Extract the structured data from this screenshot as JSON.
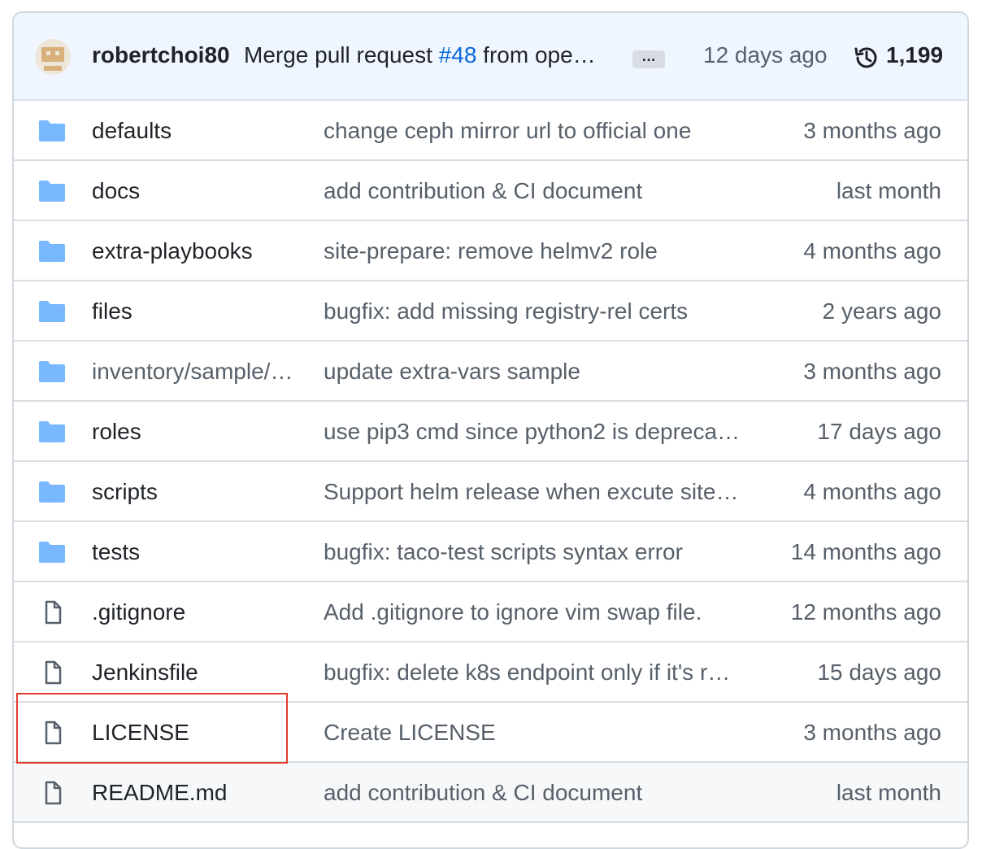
{
  "header": {
    "author": "robertchoi80",
    "message_prefix": "Merge pull request ",
    "pr_link": "#48",
    "message_suffix": " from ope…",
    "ellipsis": "…",
    "age": "12 days ago",
    "commit_count": "1,199",
    "icons": {
      "avatar": "user-avatar",
      "history": "history-clock-icon"
    }
  },
  "files": [
    {
      "type": "folder",
      "name": "defaults",
      "message": "change ceph mirror url to official one",
      "age": "3 months ago"
    },
    {
      "type": "folder",
      "name": "docs",
      "message": "add contribution & CI document",
      "age": "last month"
    },
    {
      "type": "folder",
      "name": "extra-playbooks",
      "message": "site-prepare: remove helmv2 role",
      "age": "4 months ago"
    },
    {
      "type": "folder",
      "name": "files",
      "message": "bugfix: add missing registry-rel certs",
      "age": "2 years ago"
    },
    {
      "type": "folder",
      "name": "inventory/sample/…",
      "message": "update extra-vars sample",
      "age": "3 months ago"
    },
    {
      "type": "folder",
      "name": "roles",
      "message": "use pip3 cmd since python2 is depreca…",
      "age": "17 days ago"
    },
    {
      "type": "folder",
      "name": "scripts",
      "message": "Support helm release when excute site…",
      "age": "4 months ago"
    },
    {
      "type": "folder",
      "name": "tests",
      "message": "bugfix: taco-test scripts syntax error",
      "age": "14 months ago"
    },
    {
      "type": "file",
      "name": ".gitignore",
      "message": "Add .gitignore to ignore vim swap file.",
      "age": "12 months ago"
    },
    {
      "type": "file",
      "name": "Jenkinsfile",
      "message": "bugfix: delete k8s endpoint only if it's r…",
      "age": "15 days ago"
    },
    {
      "type": "file",
      "name": "LICENSE",
      "message": "Create LICENSE",
      "age": "3 months ago"
    },
    {
      "type": "file",
      "name": "README.md",
      "message": "add contribution & CI document",
      "age": "last month"
    }
  ],
  "colors": {
    "folder": "#79b8ff",
    "file_icon": "#57606a",
    "link": "#0969da",
    "highlight": "#e03c2a",
    "header_bg": "#f0f6ff"
  }
}
